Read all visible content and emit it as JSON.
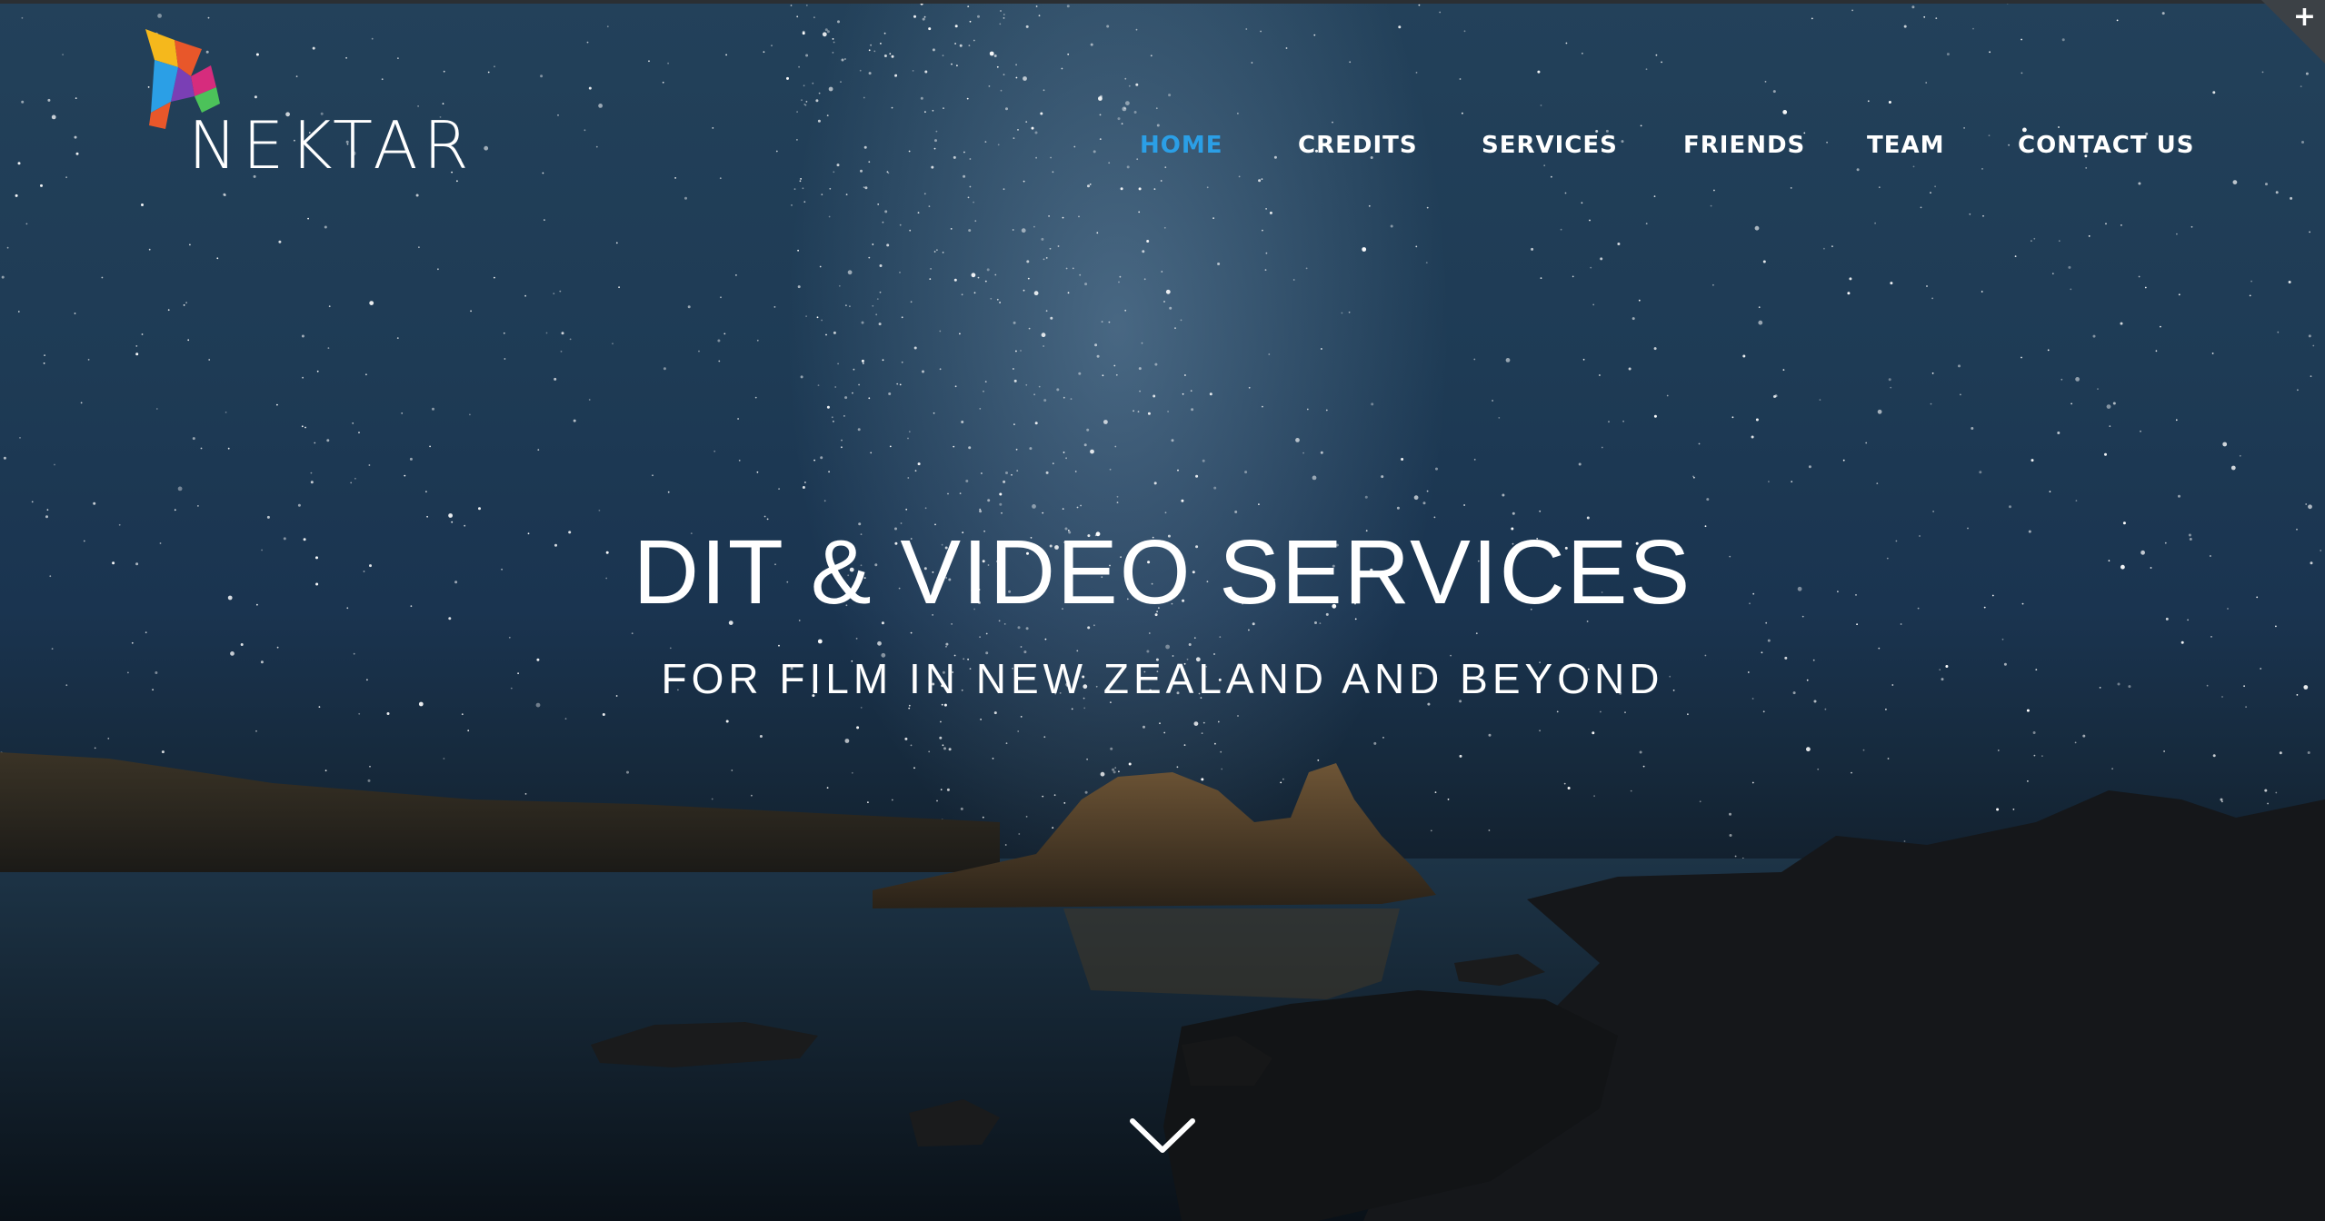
{
  "brand": {
    "name": "NEKTAR",
    "logo_colors": [
      "#f5b81c",
      "#e8572a",
      "#d62c7d",
      "#7a3fb5",
      "#2b9fe6",
      "#4cc25a"
    ]
  },
  "nav": {
    "items": [
      {
        "label": "HOME",
        "active": true
      },
      {
        "label": "CREDITS",
        "active": false
      },
      {
        "label": "SERVICES",
        "active": false
      },
      {
        "label": "FRIENDS",
        "active": false
      },
      {
        "label": "TEAM",
        "active": false
      },
      {
        "label": "CONTACT US",
        "active": false
      }
    ],
    "active_color": "#2b9fe6",
    "text_color": "#ffffff"
  },
  "hero": {
    "headline": "DIT & VIDEO SERVICES",
    "subheadline": "FOR FILM IN NEW ZEALAND AND BEYOND",
    "scroll_icon": "chevron-down-icon"
  },
  "corner_toggle": {
    "icon": "plus-icon",
    "label": "+"
  }
}
